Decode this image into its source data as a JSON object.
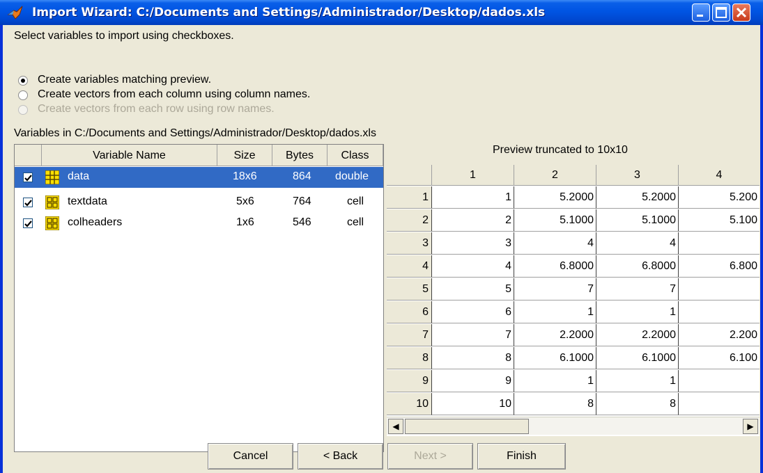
{
  "window": {
    "title": "Import Wizard: C:/Documents and Settings/Administrador/Desktop/dados.xls"
  },
  "instructions": "Select variables to import using checkboxes.",
  "radio_options": [
    {
      "label": "Create variables matching preview.",
      "selected": true,
      "disabled": false
    },
    {
      "label": "Create vectors from each column using column names.",
      "selected": false,
      "disabled": false
    },
    {
      "label": "Create vectors from each row using row names.",
      "selected": false,
      "disabled": true
    }
  ],
  "variables_label": "Variables in C:/Documents and Settings/Administrador/Desktop/dados.xls",
  "variables_table": {
    "headers": [
      "Variable Name",
      "Size",
      "Bytes",
      "Class"
    ],
    "rows": [
      {
        "name": "data",
        "size": "18x6",
        "bytes": "864",
        "class": "double",
        "checked": true,
        "selected": true,
        "icon": "matrix-icon"
      },
      {
        "name": "textdata",
        "size": "5x6",
        "bytes": "764",
        "class": "cell",
        "checked": true,
        "selected": false,
        "icon": "cell-array-icon"
      },
      {
        "name": "colheaders",
        "size": "1x6",
        "bytes": "546",
        "class": "cell",
        "checked": true,
        "selected": false,
        "icon": "cell-array-icon"
      }
    ]
  },
  "preview": {
    "title": "Preview truncated to 10x10",
    "column_headers": [
      "1",
      "2",
      "3",
      "4"
    ],
    "row_headers": [
      "1",
      "2",
      "3",
      "4",
      "5",
      "6",
      "7",
      "8",
      "9",
      "10"
    ],
    "cells": [
      [
        "1",
        "5.2000",
        "5.2000",
        "5.200"
      ],
      [
        "2",
        "5.1000",
        "5.1000",
        "5.100"
      ],
      [
        "3",
        "4",
        "4",
        ""
      ],
      [
        "4",
        "6.8000",
        "6.8000",
        "6.800"
      ],
      [
        "5",
        "7",
        "7",
        ""
      ],
      [
        "6",
        "1",
        "1",
        ""
      ],
      [
        "7",
        "2.2000",
        "2.2000",
        "2.200"
      ],
      [
        "8",
        "6.1000",
        "6.1000",
        "6.100"
      ],
      [
        "9",
        "1",
        "1",
        ""
      ],
      [
        "10",
        "8",
        "8",
        ""
      ]
    ]
  },
  "buttons": {
    "cancel": "Cancel",
    "back": "< Back",
    "next": "Next >",
    "finish": "Finish"
  },
  "colors": {
    "titlebar": "#0054e3",
    "selection": "#316ac5",
    "dialog_bg": "#ece9d8"
  }
}
